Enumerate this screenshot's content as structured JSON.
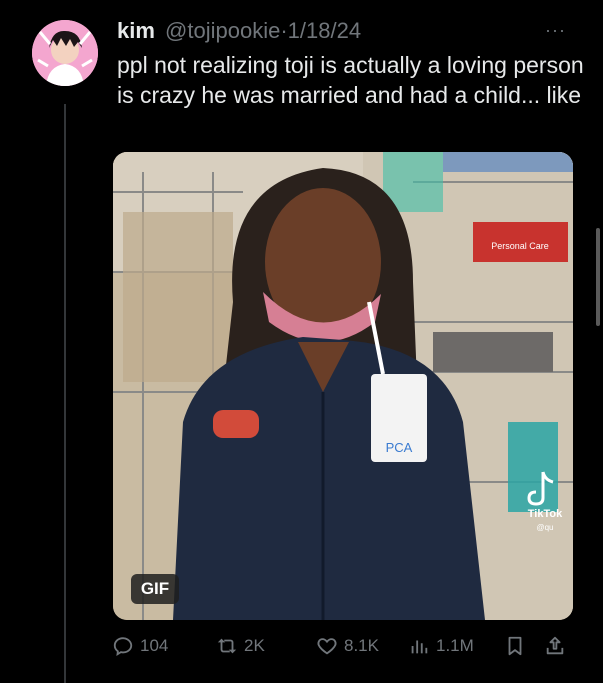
{
  "tweet": {
    "author_name": "kim",
    "handle": "@tojipookie",
    "separator": "·",
    "date": "1/18/24",
    "more": "···",
    "text": "ppl not realizing toji is actually a loving person is crazy he was married and had a child... like"
  },
  "media": {
    "type_badge": "GIF",
    "sign_text": "Personal Care",
    "badge_text": "PCA",
    "watermark_brand": "TikTok",
    "watermark_user": "@qu"
  },
  "actions": {
    "replies": "104",
    "reposts": "2K",
    "likes": "8.1K",
    "views": "1.1M"
  },
  "icons": {
    "reply": "reply-icon",
    "repost": "repost-icon",
    "like": "heart-icon",
    "views": "views-icon",
    "bookmark": "bookmark-icon",
    "share": "share-icon"
  },
  "colors": {
    "background": "#000000",
    "text_primary": "#e7e9ea",
    "text_secondary": "#71767b"
  }
}
